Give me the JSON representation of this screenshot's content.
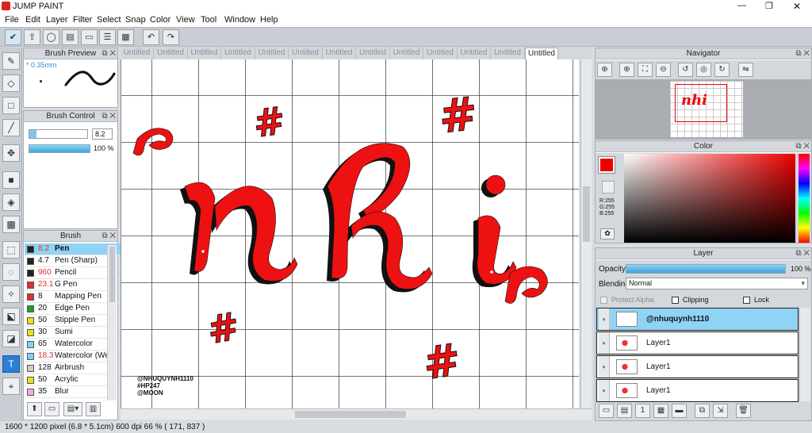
{
  "app": {
    "title": "JUMP PAINT"
  },
  "window_controls": {
    "minimize": "—",
    "maximize": "❐",
    "close": "✕"
  },
  "menu": [
    "File",
    "Edit",
    "Layer",
    "Filter",
    "Select",
    "Snap",
    "Color",
    "View",
    "Tool",
    "Window",
    "Help"
  ],
  "brush_preview": {
    "title": "Brush Preview",
    "size": "* 0.35mm"
  },
  "brush_control": {
    "title": "Brush Control",
    "size_value": "8.2",
    "opacity_value": "100 %"
  },
  "brush_panel": {
    "title": "Brush",
    "items": [
      {
        "size": "8.2",
        "name": "Pen",
        "color": "#222222",
        "selected": true,
        "size_red": true
      },
      {
        "size": "4.7",
        "name": "Pen (Sharp)",
        "color": "#222222"
      },
      {
        "size": "960",
        "name": "Pencil",
        "color": "#222222",
        "size_red": true
      },
      {
        "size": "23.1",
        "name": "G Pen",
        "color": "#e03030",
        "size_red": true
      },
      {
        "size": "8",
        "name": "Mapping Pen",
        "color": "#e03030"
      },
      {
        "size": "20",
        "name": "Edge Pen",
        "color": "#20a020"
      },
      {
        "size": "50",
        "name": "Stipple Pen",
        "color": "#e8e020"
      },
      {
        "size": "30",
        "name": "Sumi",
        "color": "#e8e020"
      },
      {
        "size": "65",
        "name": "Watercolor",
        "color": "#7fd4f5"
      },
      {
        "size": "18.3",
        "name": "Watercolor (We",
        "color": "#7fd4f5",
        "size_red": true
      },
      {
        "size": "128",
        "name": "Airbrush",
        "color": "#cccccc"
      },
      {
        "size": "50",
        "name": "Acrylic",
        "color": "#e8e020"
      },
      {
        "size": "35",
        "name": "Blur",
        "color": "#f5a8e8"
      }
    ]
  },
  "tabs": [
    "Untitled",
    "Untitled",
    "Untitled",
    "Untitled",
    "Untitled",
    "Untitled",
    "Untitled",
    "Untitled",
    "Untitled",
    "Untitled",
    "Untitled",
    "Untitled",
    "Untitled"
  ],
  "canvas": {
    "watermark": [
      "@NHUQUYNH1110",
      "#HP247",
      "@MOON"
    ],
    "artwork_text": "nhi"
  },
  "navigator": {
    "title": "Navigator"
  },
  "color_panel": {
    "title": "Color",
    "r": "R:255",
    "g": "G:255",
    "b": "B:255"
  },
  "layer_panel": {
    "title": "Layer",
    "opacity_label": "Opacity",
    "opacity_value": "100 %",
    "blending_label": "Blending",
    "blending_value": "Normal",
    "protect_alpha": "Protect Alpha",
    "clipping": "Clipping",
    "lock": "Lock",
    "layers": [
      {
        "name": "@nhuquynh1110",
        "selected": true
      },
      {
        "name": "Layer1"
      },
      {
        "name": "Layer1"
      },
      {
        "name": "Layer1"
      }
    ]
  },
  "status": {
    "text": "1600 * 1200 pixel   (6.8 * 5.1cm)   600 dpi   66 %   ( 171, 837 )"
  },
  "colors": {
    "accent": "#2b7fd4",
    "selection": "#8fd3f5",
    "art_red": "#ee1111"
  }
}
